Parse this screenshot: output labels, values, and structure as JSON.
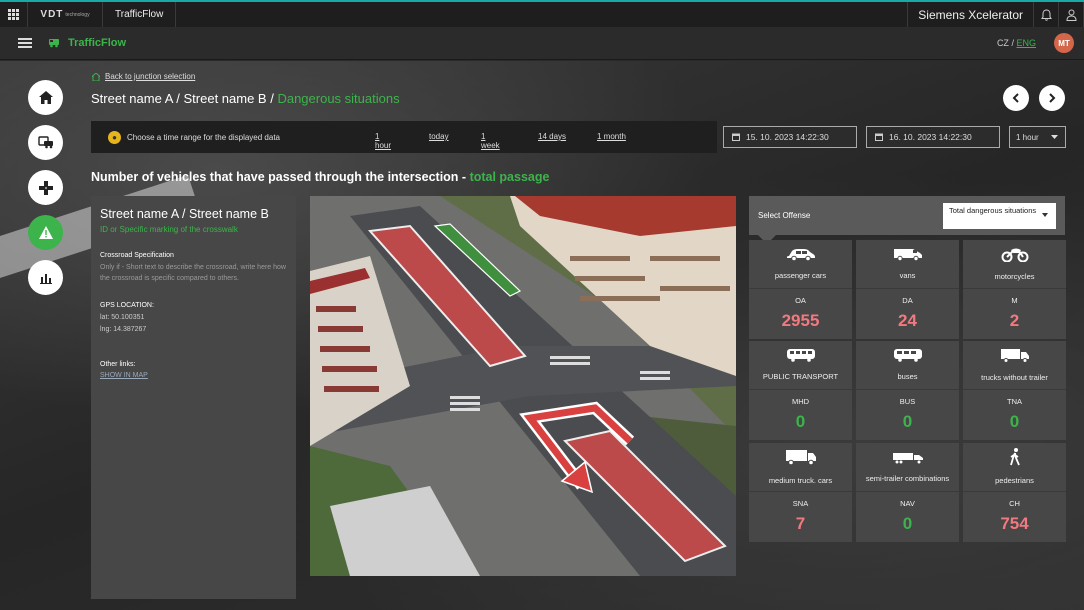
{
  "topbar": {
    "logo_text": "VDT",
    "logo_sub": "technology",
    "app_tab": "TrafficFlow",
    "company": "Siemens Xcelerator"
  },
  "appbar": {
    "title": "TrafficFlow",
    "lang_cz": "CZ",
    "lang_sep": "/",
    "lang_eng": "ENG",
    "avatar_initials": "MT"
  },
  "header": {
    "back_link": "Back to junction selection",
    "title_prefix": "Street name A / Street name B /",
    "title_highlight": "Dangerous situations"
  },
  "filters": {
    "hint": "Choose a time range for the displayed data",
    "ranges": [
      "1 hour",
      "today",
      "1 week",
      "14 days",
      "1 month"
    ],
    "date_from": "15. 10. 2023 14:22:30",
    "date_to": "16. 10. 2023 14:22:30",
    "interval": "1 hour"
  },
  "section": {
    "title": "Number of vehicles that have passed through the intersection -",
    "highlight": "total passage"
  },
  "info": {
    "title": "Street name A / Street name B",
    "subtitle": "ID or Specific marking of the crosswalk",
    "spec_label": "Crossroad Specification",
    "spec_text": "Only if - Short text to describe the crossroad, write here how the crossroad is specific compared to others.",
    "gps_label": "GPS LOCATION:",
    "lat": "lat: 50.100351",
    "lng": "lng: 14.387267",
    "links_label": "Other links:",
    "map_link": "SHOW IN MAP"
  },
  "offense": {
    "label": "Select Offense",
    "selected": "Total dangerous situations"
  },
  "tiles": [
    {
      "name": "passenger cars",
      "code": "OA",
      "value": "2955",
      "icon": "car-icon"
    },
    {
      "name": "vans",
      "code": "DA",
      "value": "24",
      "icon": "van-icon"
    },
    {
      "name": "motorcycles",
      "code": "M",
      "value": "2",
      "icon": "motorcycle-icon"
    },
    {
      "name": "PUBLIC TRANSPORT",
      "code": "MHD",
      "value": "0",
      "icon": "tram-icon"
    },
    {
      "name": "buses",
      "code": "BUS",
      "value": "0",
      "icon": "bus-icon"
    },
    {
      "name": "trucks without trailer",
      "code": "TNA",
      "value": "0",
      "icon": "truck-icon"
    },
    {
      "name": "medium truck. cars",
      "code": "SNA",
      "value": "7",
      "icon": "medium-truck-icon"
    },
    {
      "name": "semi-trailer combinations",
      "code": "NAV",
      "value": "0",
      "icon": "semi-trailer-icon"
    },
    {
      "name": "pedestrians",
      "code": "CH",
      "value": "754",
      "icon": "pedestrian-icon"
    }
  ],
  "colors": {
    "accent_green": "#3cb44b",
    "value_red": "#f07a80",
    "value_green": "#3cb44b",
    "teal_line": "#1aa8a8"
  }
}
